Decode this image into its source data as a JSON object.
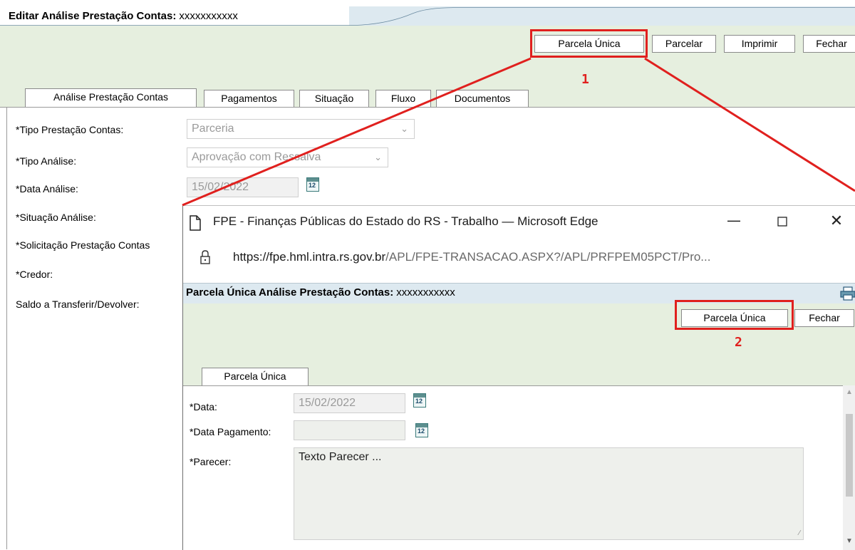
{
  "main": {
    "title": "Editar Análise Prestação Contas:",
    "title_code": "xxxxxxxxxxx",
    "toolbar": {
      "parcela_unica": "Parcela Única",
      "parcelar": "Parcelar",
      "imprimir": "Imprimir",
      "fechar": "Fechar"
    },
    "tabs": [
      "Análise Prestação Contas",
      "Pagamentos",
      "Situação",
      "Fluxo",
      "Documentos"
    ],
    "fields": {
      "tipo_prestacao_label": "*Tipo Prestação Contas:",
      "tipo_prestacao_value": "Parceria",
      "tipo_analise_label": "*Tipo Análise:",
      "tipo_analise_value": "Aprovação com Ressalva",
      "data_analise_label": "*Data Análise:",
      "data_analise_value": "15/02/2022",
      "situacao_label": "*Situação Análise:",
      "solicitacao_label": "*Solicitação Prestação Contas",
      "credor_label": "*Credor:",
      "saldo_label": "Saldo a Transferir/Devolver:"
    }
  },
  "popup": {
    "window_title": "FPE - Finanças Públicas do Estado do RS - Trabalho — Microsoft Edge",
    "url_host": "https://fpe.hml.intra.rs.gov.br",
    "url_path": "/APL/FPE-TRANSACAO.ASPX?/APL/PRFPEM05PCT/Pro...",
    "header_title": "Parcela Única Análise Prestação Contas:",
    "header_code": "xxxxxxxxxxx",
    "toolbar": {
      "parcela_unica": "Parcela Única",
      "fechar": "Fechar"
    },
    "tab": "Parcela Única",
    "fields": {
      "data_label": "*Data:",
      "data_value": "15/02/2022",
      "data_pagamento_label": "*Data Pagamento:",
      "data_pagamento_value": "",
      "parecer_label": "*Parecer:",
      "parecer_value": "Texto Parecer ..."
    }
  },
  "annotations": {
    "step1": "1",
    "step2": "2",
    "color": "#e0201e"
  },
  "icons": {
    "calendar": "calendar-icon",
    "calendar_day": "12",
    "page": "page-icon",
    "lock": "lock-icon",
    "printer": "printer-icon",
    "minimize": "—",
    "close": "✕"
  }
}
